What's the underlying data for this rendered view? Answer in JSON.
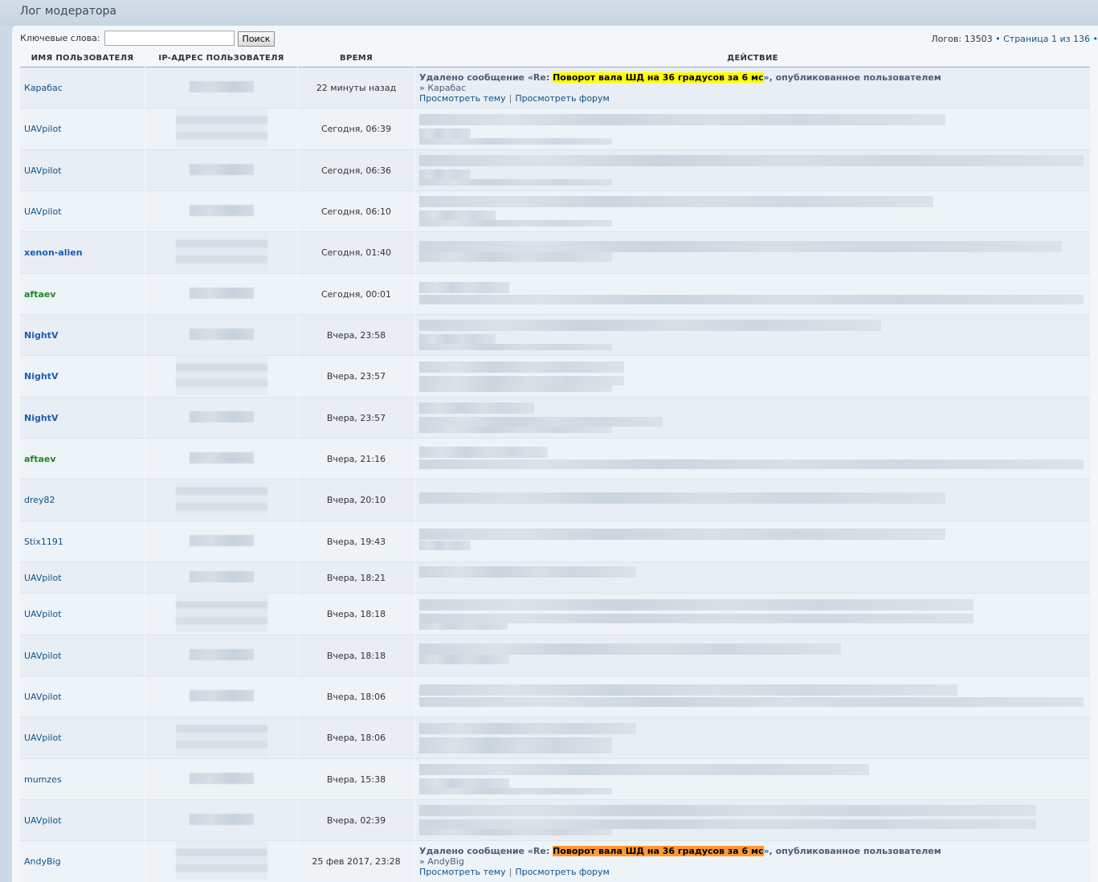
{
  "page_title": "Лог модератора",
  "search": {
    "label": "Ключевые слова:",
    "value": "",
    "placeholder": "",
    "button": "Поиск"
  },
  "pagination": {
    "logs_label": "Логов: 13503",
    "bullet": "•",
    "page_label": "Страница",
    "current": "1",
    "of": "из",
    "total": "136"
  },
  "columns": {
    "user": "Имя пользователя",
    "ip": "IP-адрес пользователя",
    "time": "Время",
    "action": "Действие"
  },
  "rows": [
    {
      "user": "Карабас",
      "style": "normal",
      "time": "22 минуты назад",
      "visible": true,
      "action_prefix": "Удалено сообщение «Re: ",
      "action_topic": "Поворот вала ШД на 36 градусов за 6 мс",
      "action_suffix": "», опубликованное пользователем",
      "action_sub": "» Карабас",
      "link_topic": "Просмотреть тему",
      "link_forum": "Просмотреть форум",
      "highlight": "yellow"
    },
    {
      "user": "UAVpilot",
      "style": "normal",
      "time": "Сегодня, 06:39"
    },
    {
      "user": "UAVpilot",
      "style": "normal",
      "time": "Сегодня, 06:36"
    },
    {
      "user": "UAVpilot",
      "style": "normal",
      "time": "Сегодня, 06:10"
    },
    {
      "user": "xenon-alien",
      "style": "blue",
      "time": "Сегодня, 01:40"
    },
    {
      "user": "aftaev",
      "style": "green",
      "time": "Сегодня, 00:01"
    },
    {
      "user": "NightV",
      "style": "blue",
      "time": "Вчера, 23:58"
    },
    {
      "user": "NightV",
      "style": "blue",
      "time": "Вчера, 23:57"
    },
    {
      "user": "NightV",
      "style": "blue",
      "time": "Вчера, 23:57"
    },
    {
      "user": "aftaev",
      "style": "green",
      "time": "Вчера, 21:16"
    },
    {
      "user": "drey82",
      "style": "normal",
      "time": "Вчера, 20:10"
    },
    {
      "user": "Stix1191",
      "style": "normal",
      "time": "Вчера, 19:43"
    },
    {
      "user": "UAVpilot",
      "style": "normal",
      "time": "Вчера, 18:21"
    },
    {
      "user": "UAVpilot",
      "style": "normal",
      "time": "Вчера, 18:18"
    },
    {
      "user": "UAVpilot",
      "style": "normal",
      "time": "Вчера, 18:18"
    },
    {
      "user": "UAVpilot",
      "style": "normal",
      "time": "Вчера, 18:06"
    },
    {
      "user": "UAVpilot",
      "style": "normal",
      "time": "Вчера, 18:06"
    },
    {
      "user": "mumzes",
      "style": "normal",
      "time": "Вчера, 15:38"
    },
    {
      "user": "UAVpilot",
      "style": "normal",
      "time": "Вчера, 02:39"
    },
    {
      "user": "AndyBig",
      "style": "normal",
      "time": "25 фев 2017, 23:28",
      "visible": true,
      "action_prefix": "Удалено сообщение «Re: ",
      "action_topic": "Поворот вала ШД на 36 градусов за 6 мс",
      "action_suffix": "», опубликованное пользователем",
      "action_sub": "» AndyBig",
      "link_topic": "Просмотреть тему",
      "link_forum": "Просмотреть форум",
      "highlight": "orange"
    }
  ]
}
